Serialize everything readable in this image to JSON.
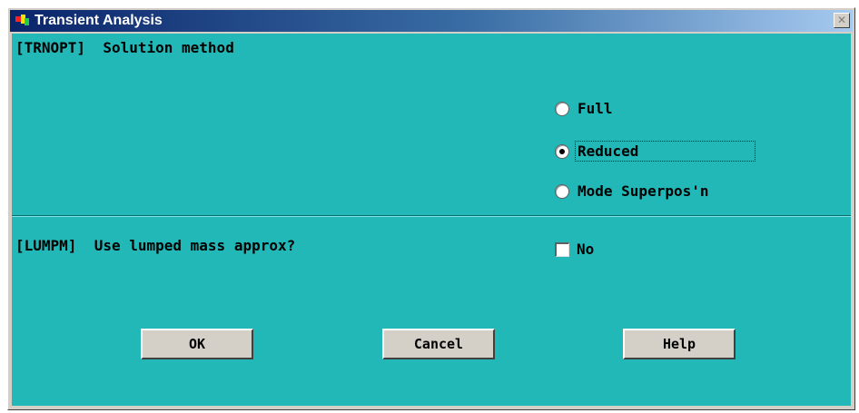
{
  "window": {
    "title": "Transient Analysis",
    "close_glyph": "✕"
  },
  "trnopt": {
    "label": "[TRNOPT]  Solution method",
    "options": [
      {
        "label": "Full",
        "selected": false
      },
      {
        "label": "Reduced",
        "selected": true
      },
      {
        "label": "Mode Superpos'n",
        "selected": false
      }
    ]
  },
  "lumpm": {
    "label": "[LUMPM]  Use lumped mass approx?",
    "checkbox_label": "No",
    "checked": false
  },
  "buttons": {
    "ok": "OK",
    "cancel": "Cancel",
    "help": "Help"
  },
  "colors": {
    "panel": "#23b8b8",
    "title_bar": "#0a246a",
    "button_face": "#d4d0c8"
  }
}
